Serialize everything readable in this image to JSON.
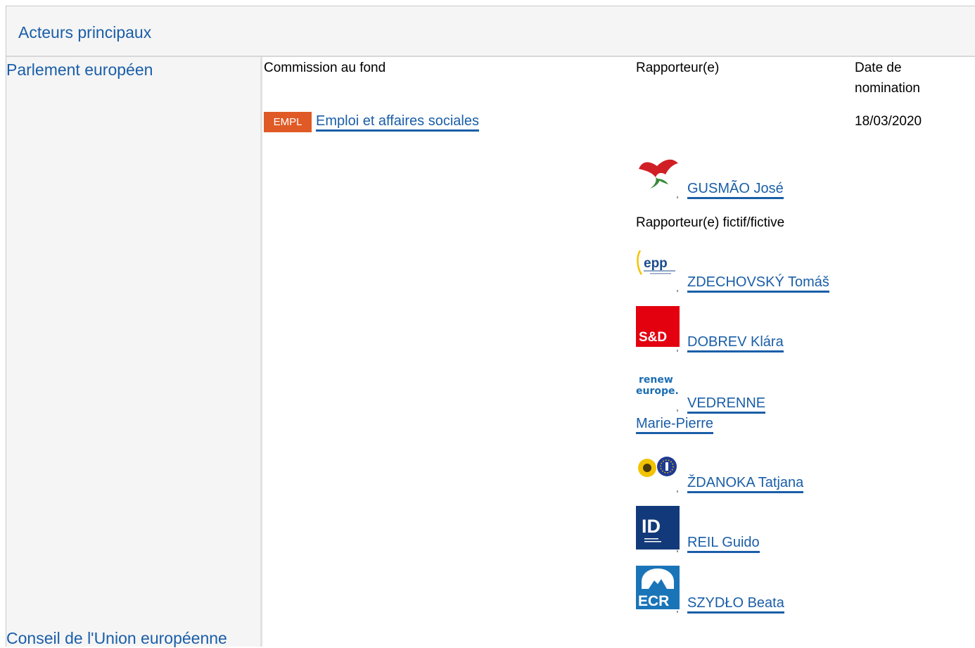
{
  "section_title": "Acteurs principaux",
  "institutions": {
    "parliament": "Parlement européen",
    "council": "Conseil de l'Union européenne"
  },
  "table_headers": {
    "committee": "Commission au fond",
    "rapporteur": "Rapporteur(e)",
    "date_line1": "Date de",
    "date_line2": "nomination"
  },
  "committee": {
    "badge": "EMPL",
    "badge_color": "#e05a25",
    "name": "Emploi et affaires sociales",
    "date": "18/03/2020"
  },
  "rapporteur": {
    "name": "GUSMÃO José",
    "group_icon": "pse-rose-logo"
  },
  "shadow_label": "Rapporteur(e) fictif/fictive",
  "shadow_rapporteurs": [
    {
      "name": "ZDECHOVSKÝ Tomáš",
      "group_icon": "epp-logo",
      "logo_text": "epp"
    },
    {
      "name": "DOBREV Klára",
      "group_icon": "sd-logo",
      "logo_text": "S&D"
    },
    {
      "name_line1": "VEDRENNE",
      "name_line2": "Marie-Pierre",
      "group_icon": "renew-europe-logo",
      "logo_line1": "renew",
      "logo_line2": "europe."
    },
    {
      "name": "ŽDANOKA Tatjana",
      "group_icon": "greens-efa-logo"
    },
    {
      "name": "REIL Guido",
      "group_icon": "id-logo",
      "logo_text": "ID"
    },
    {
      "name": "SZYDŁO Beata",
      "group_icon": "ecr-logo",
      "logo_text": "ECR"
    }
  ],
  "colors": {
    "link": "#1a5ea8",
    "header_bg": "#f5f5f5"
  }
}
